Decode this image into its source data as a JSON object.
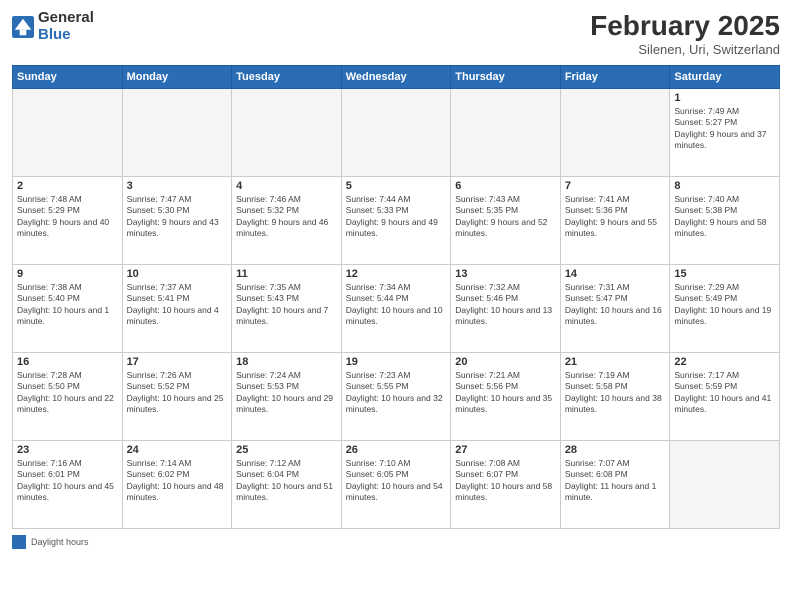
{
  "logo": {
    "general": "General",
    "blue": "Blue"
  },
  "title": "February 2025",
  "location": "Silenen, Uri, Switzerland",
  "days_of_week": [
    "Sunday",
    "Monday",
    "Tuesday",
    "Wednesday",
    "Thursday",
    "Friday",
    "Saturday"
  ],
  "weeks": [
    [
      {
        "day": "",
        "info": ""
      },
      {
        "day": "",
        "info": ""
      },
      {
        "day": "",
        "info": ""
      },
      {
        "day": "",
        "info": ""
      },
      {
        "day": "",
        "info": ""
      },
      {
        "day": "",
        "info": ""
      },
      {
        "day": "1",
        "info": "Sunrise: 7:49 AM\nSunset: 5:27 PM\nDaylight: 9 hours and 37 minutes."
      }
    ],
    [
      {
        "day": "2",
        "info": "Sunrise: 7:48 AM\nSunset: 5:29 PM\nDaylight: 9 hours and 40 minutes."
      },
      {
        "day": "3",
        "info": "Sunrise: 7:47 AM\nSunset: 5:30 PM\nDaylight: 9 hours and 43 minutes."
      },
      {
        "day": "4",
        "info": "Sunrise: 7:46 AM\nSunset: 5:32 PM\nDaylight: 9 hours and 46 minutes."
      },
      {
        "day": "5",
        "info": "Sunrise: 7:44 AM\nSunset: 5:33 PM\nDaylight: 9 hours and 49 minutes."
      },
      {
        "day": "6",
        "info": "Sunrise: 7:43 AM\nSunset: 5:35 PM\nDaylight: 9 hours and 52 minutes."
      },
      {
        "day": "7",
        "info": "Sunrise: 7:41 AM\nSunset: 5:36 PM\nDaylight: 9 hours and 55 minutes."
      },
      {
        "day": "8",
        "info": "Sunrise: 7:40 AM\nSunset: 5:38 PM\nDaylight: 9 hours and 58 minutes."
      }
    ],
    [
      {
        "day": "9",
        "info": "Sunrise: 7:38 AM\nSunset: 5:40 PM\nDaylight: 10 hours and 1 minute."
      },
      {
        "day": "10",
        "info": "Sunrise: 7:37 AM\nSunset: 5:41 PM\nDaylight: 10 hours and 4 minutes."
      },
      {
        "day": "11",
        "info": "Sunrise: 7:35 AM\nSunset: 5:43 PM\nDaylight: 10 hours and 7 minutes."
      },
      {
        "day": "12",
        "info": "Sunrise: 7:34 AM\nSunset: 5:44 PM\nDaylight: 10 hours and 10 minutes."
      },
      {
        "day": "13",
        "info": "Sunrise: 7:32 AM\nSunset: 5:46 PM\nDaylight: 10 hours and 13 minutes."
      },
      {
        "day": "14",
        "info": "Sunrise: 7:31 AM\nSunset: 5:47 PM\nDaylight: 10 hours and 16 minutes."
      },
      {
        "day": "15",
        "info": "Sunrise: 7:29 AM\nSunset: 5:49 PM\nDaylight: 10 hours and 19 minutes."
      }
    ],
    [
      {
        "day": "16",
        "info": "Sunrise: 7:28 AM\nSunset: 5:50 PM\nDaylight: 10 hours and 22 minutes."
      },
      {
        "day": "17",
        "info": "Sunrise: 7:26 AM\nSunset: 5:52 PM\nDaylight: 10 hours and 25 minutes."
      },
      {
        "day": "18",
        "info": "Sunrise: 7:24 AM\nSunset: 5:53 PM\nDaylight: 10 hours and 29 minutes."
      },
      {
        "day": "19",
        "info": "Sunrise: 7:23 AM\nSunset: 5:55 PM\nDaylight: 10 hours and 32 minutes."
      },
      {
        "day": "20",
        "info": "Sunrise: 7:21 AM\nSunset: 5:56 PM\nDaylight: 10 hours and 35 minutes."
      },
      {
        "day": "21",
        "info": "Sunrise: 7:19 AM\nSunset: 5:58 PM\nDaylight: 10 hours and 38 minutes."
      },
      {
        "day": "22",
        "info": "Sunrise: 7:17 AM\nSunset: 5:59 PM\nDaylight: 10 hours and 41 minutes."
      }
    ],
    [
      {
        "day": "23",
        "info": "Sunrise: 7:16 AM\nSunset: 6:01 PM\nDaylight: 10 hours and 45 minutes."
      },
      {
        "day": "24",
        "info": "Sunrise: 7:14 AM\nSunset: 6:02 PM\nDaylight: 10 hours and 48 minutes."
      },
      {
        "day": "25",
        "info": "Sunrise: 7:12 AM\nSunset: 6:04 PM\nDaylight: 10 hours and 51 minutes."
      },
      {
        "day": "26",
        "info": "Sunrise: 7:10 AM\nSunset: 6:05 PM\nDaylight: 10 hours and 54 minutes."
      },
      {
        "day": "27",
        "info": "Sunrise: 7:08 AM\nSunset: 6:07 PM\nDaylight: 10 hours and 58 minutes."
      },
      {
        "day": "28",
        "info": "Sunrise: 7:07 AM\nSunset: 6:08 PM\nDaylight: 11 hours and 1 minute."
      },
      {
        "day": "",
        "info": ""
      }
    ]
  ],
  "legend": {
    "daylight_hours_label": "Daylight hours"
  }
}
